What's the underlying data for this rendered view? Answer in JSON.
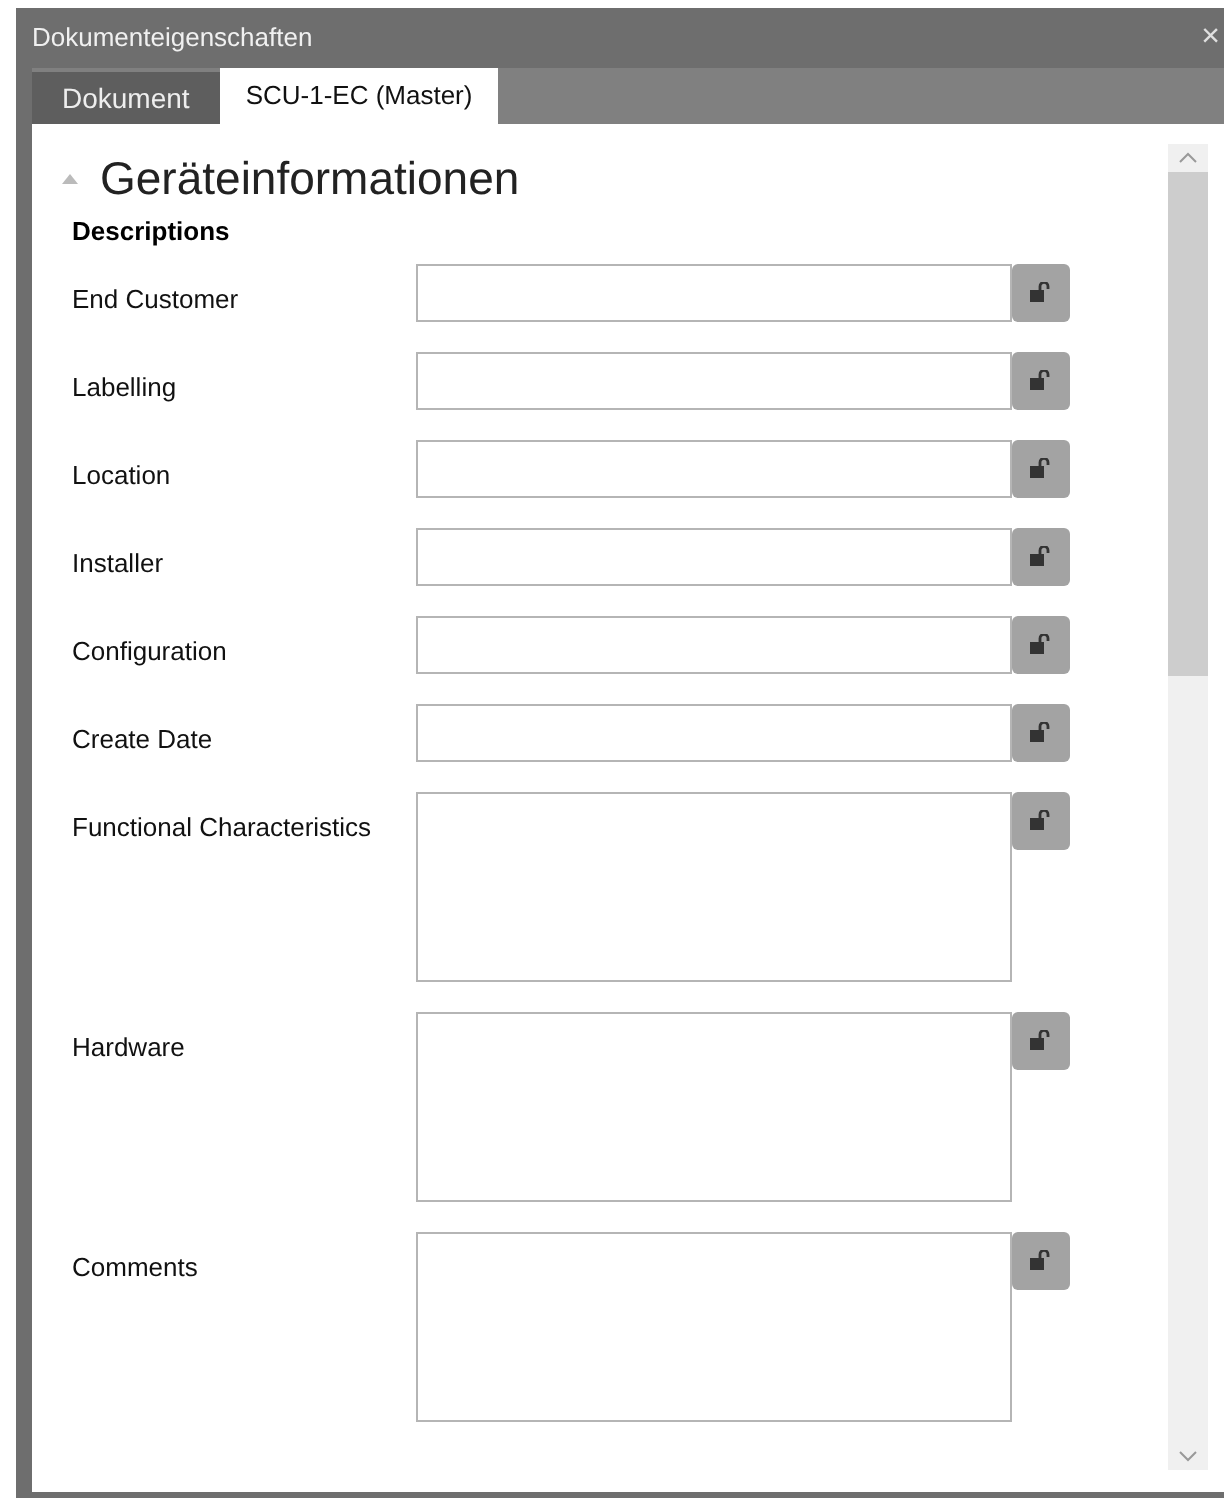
{
  "window": {
    "title": "Dokumenteigenschaften",
    "close": "×"
  },
  "tabs": [
    {
      "label": "Dokument",
      "selected": false
    },
    {
      "label": "SCU-1-EC (Master)",
      "selected": true
    }
  ],
  "section": {
    "title": "Geräteinformationen",
    "expanded": true,
    "group": "Descriptions"
  },
  "fields": [
    {
      "label": "End Customer",
      "kind": "single",
      "locked": false
    },
    {
      "label": "Labelling",
      "kind": "single",
      "locked": false
    },
    {
      "label": "Location",
      "kind": "single",
      "locked": false
    },
    {
      "label": "Installer",
      "kind": "single",
      "locked": false
    },
    {
      "label": "Configuration",
      "kind": "single",
      "locked": false
    },
    {
      "label": "Create Date",
      "kind": "single",
      "locked": false
    },
    {
      "label": "Functional Characteristics",
      "kind": "multi",
      "locked": false
    },
    {
      "label": "Hardware",
      "kind": "multi",
      "locked": false
    },
    {
      "label": "Comments",
      "kind": "multi",
      "locked": false
    }
  ]
}
